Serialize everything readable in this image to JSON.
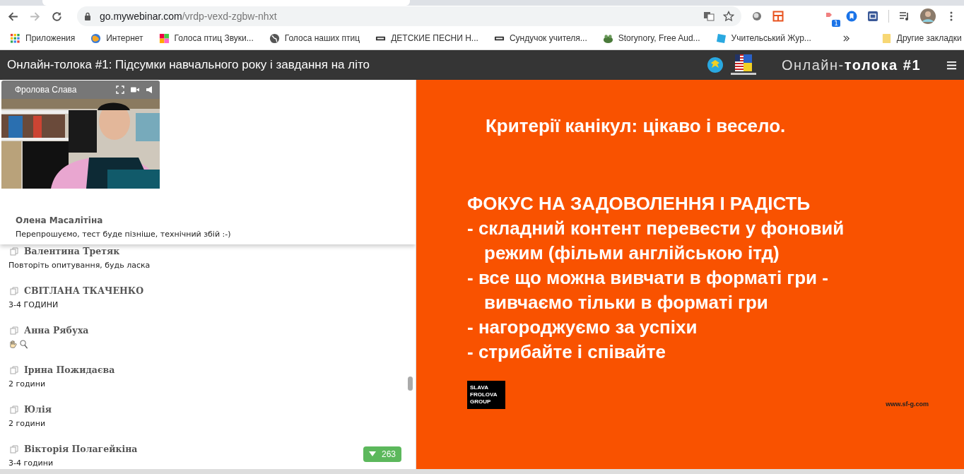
{
  "browser": {
    "url_host": "go.mywebinar.com",
    "url_path": "/vrdp-vexd-zgbw-nhxt",
    "extension_badge": "1",
    "bookmarks": [
      {
        "label": "Приложения",
        "kind": "apps"
      },
      {
        "label": "Интернет",
        "kind": "globe"
      },
      {
        "label": "Голоса птиц Звуки...",
        "kind": "tiles"
      },
      {
        "label": "Голоса наших птиц",
        "kind": "world"
      },
      {
        "label": "ДЕТСКИЕ ПЕСНИ Н...",
        "kind": "vk"
      },
      {
        "label": "Сундучок учителя...",
        "kind": "vk"
      },
      {
        "label": "Storynory, Free Aud...",
        "kind": "frog"
      },
      {
        "label": "Учительський Жур...",
        "kind": "square"
      }
    ],
    "other_bookmarks": "Другие закладки"
  },
  "header": {
    "title": "Онлайн-толока #1: Підсумки навчального року і завдання на літо",
    "brand_light": "Онлайн-",
    "brand_bold": "толока #1"
  },
  "video": {
    "presenter": "Фролова Слава"
  },
  "pinned": {
    "author": "Олена Масалітіна",
    "text": "Перепрошуємо, тест буде пізніше, технічний збій :-)"
  },
  "chat": [
    {
      "author": "Валентина Третяк",
      "kind": "text",
      "text": "Повторіть опитування, будь ласка"
    },
    {
      "author": "СВІТЛАНА ТКАЧЕНКО",
      "kind": "text",
      "text": "3-4 ГОДИНИ"
    },
    {
      "author": "Анна Рябуха",
      "kind": "emoji"
    },
    {
      "author": "Ірина Пожидаєва",
      "kind": "text",
      "text": "2 години"
    },
    {
      "author": "Юлія",
      "kind": "text",
      "text": "2 години"
    },
    {
      "author": "Вікторія Полагейкіна",
      "kind": "text",
      "text": "3-4 години"
    }
  ],
  "unread_count": "263",
  "slide": {
    "title": "Критерії канікул: цікаво і весело.",
    "lines": [
      {
        "kind": "heading",
        "text": "ФОКУС НА ЗАДОВОЛЕННЯ І РАДІСТЬ"
      },
      {
        "kind": "bullet",
        "text": "- складний контент перевести у фоновий"
      },
      {
        "kind": "continuation",
        "text": "режим (фільми англійською ітд)"
      },
      {
        "kind": "bullet",
        "text": "- все що можна вивчати в форматі гри -"
      },
      {
        "kind": "continuation",
        "text": "вивчаємо тільки в форматі гри"
      },
      {
        "kind": "bullet",
        "text": "- нагороджуємо за успіхи"
      },
      {
        "kind": "bullet",
        "text": "- стрибайте і співайте"
      }
    ],
    "logo": [
      "SLAVA",
      "FROLOVA",
      "GROUP"
    ],
    "website": "www.sf-g.com"
  }
}
